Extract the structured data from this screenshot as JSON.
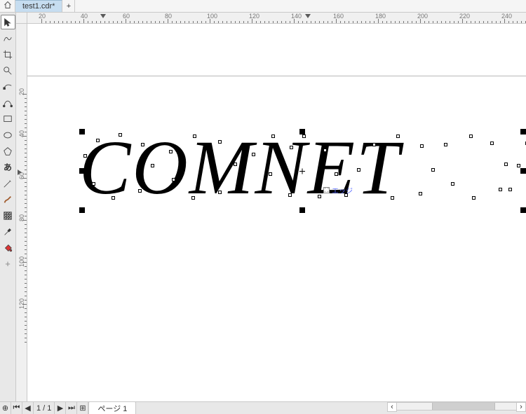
{
  "tab": {
    "filename": "test1.cdr*",
    "home_icon": "home-icon",
    "add_icon": "plus-icon"
  },
  "ruler_h": {
    "start": 20,
    "step": 20,
    "end": 240
  },
  "ruler_v": {
    "start": 20,
    "step": 20,
    "end": 120
  },
  "canvas": {
    "text_object": "COMNET",
    "hint_label": "エッジ",
    "selection_center": "×"
  },
  "toolbox": {
    "tools": [
      "select-tool",
      "freehand-tool",
      "crop-tool",
      "zoom-tool",
      "shape-edit-tool",
      "bezier-tool",
      "rectangle-tool",
      "ellipse-tool",
      "polygon-tool",
      "text-tool",
      "pen-tool",
      "brush-tool",
      "transparency-tool",
      "eyedropper-tool",
      "fill-tool",
      "add-tool"
    ]
  },
  "pagenav": {
    "current": "1",
    "total": "1",
    "page_label": "ページ 1",
    "first": "⏮",
    "prev": "◀",
    "next": "▶",
    "last": "⏭",
    "add": "＋",
    "scroll_left": "‹",
    "scroll_right": "›"
  }
}
